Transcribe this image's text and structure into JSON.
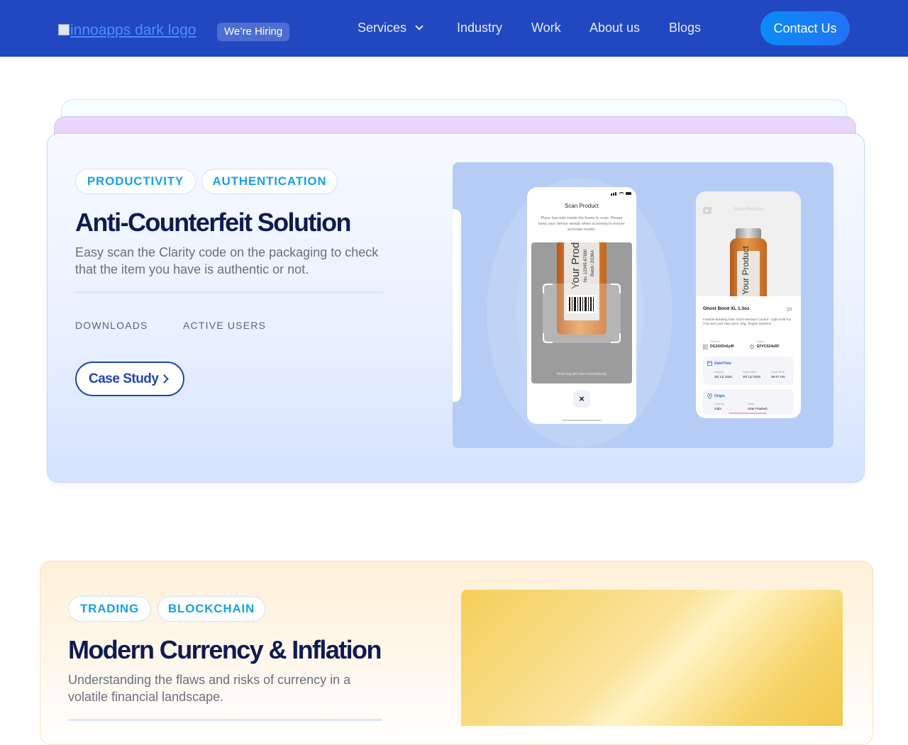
{
  "header": {
    "logo_alt": "innoapps dark logo",
    "hiring_badge": "We’re Hiring",
    "nav": [
      {
        "label": "Services",
        "has_dropdown": true
      },
      {
        "label": "Industry"
      },
      {
        "label": "Work"
      },
      {
        "label": "About us"
      },
      {
        "label": "Blogs"
      }
    ],
    "contact_label": "Contact Us"
  },
  "projects": [
    {
      "tags": [
        "PRODUCTIVITY",
        "AUTHENTICATION"
      ],
      "title": "Anti-Counterfeit Solution",
      "description": "Easy scan the Clarity code on the packaging to check that the item you have is authentic or not.",
      "stats": [
        "DOWNLOADS",
        "ACTIVE USERS"
      ],
      "cta_label": "Case Study",
      "showcase": {
        "phone1": {
          "title": "Scan Product",
          "instruction": "Place barcode inside the frame to scan. Please keep your device steady when scanning to ensure accurate results.",
          "bottle_label": "Your Product",
          "bottle_code": "No. 12345-67890",
          "bottle_batch": "Batch: 2G36A",
          "scan_hint": "Scanning will start automatically",
          "close_symbol": "×"
        },
        "phone2": {
          "title": "Scan Product",
          "bottle_label": "Your Product",
          "product_name": "Ghost Bond XL 1.3oz",
          "product_desc": "Invisible Bonding Glue: Extra Moisture Control - Light Hold For Poly and Lace Hair piece, Wig, Toupee Systems",
          "scan_id_label": "Scan ID",
          "scan_id": "DG34XDv6y4F",
          "batch_label": "Batch",
          "batch": "EFVCS34sRF",
          "datetime_label": "Date/Time",
          "expires_label": "Expires",
          "expires": "30/ 12/ 2020",
          "scan_date_label": "Scan Date",
          "scan_date": "20/ 12/ 2020",
          "scan_time_label": "Scan Time",
          "scan_time": "09:47 Hrs",
          "origin_label": "Origin",
          "country_label": "Country",
          "country": "India",
          "state_label": "State",
          "state": "Uttar Pradesh"
        }
      }
    },
    {
      "tags": [
        "TRADING",
        "BLOCKCHAIN"
      ],
      "title": "Modern Currency & Inflation",
      "description": "Understanding the flaws and risks of currency in a volatile financial landscape."
    }
  ],
  "colors": {
    "header_bg": "#2148c0",
    "contact_bg": "#0b8cf7",
    "tag_text": "#17a0ea",
    "title": "#101a52",
    "cta_border": "#1f45b4",
    "card1_bg": "#eaf1ff",
    "card2_bg": "#fff0d9",
    "showcase_bg": "#b5cdf5",
    "gold_bg": "#f7d56b"
  },
  "icons": [
    "chevron-down-icon",
    "chevron-right-icon",
    "close-icon",
    "back-arrow-icon",
    "calendar-icon",
    "location-pin-icon",
    "flag-icon",
    "barcode-icon",
    "tag-icon",
    "signal-icon",
    "wifi-icon",
    "battery-icon"
  ]
}
